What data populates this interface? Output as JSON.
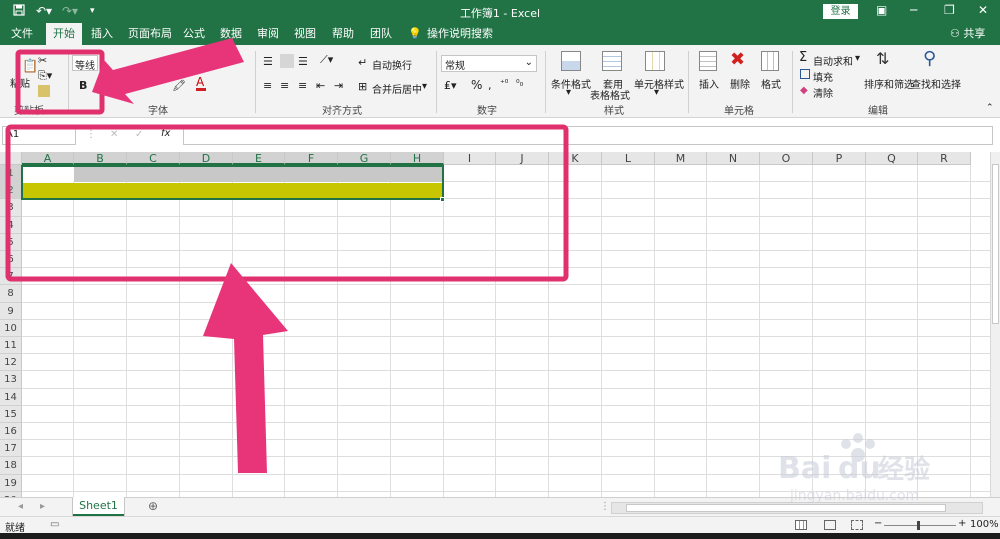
{
  "app": {
    "window_title": "工作簿1 - Excel",
    "login_label": "登录",
    "share_label": "共享"
  },
  "tabs": [
    "文件",
    "开始",
    "插入",
    "页面布局",
    "公式",
    "数据",
    "审阅",
    "视图",
    "帮助",
    "团队",
    "操作说明搜索"
  ],
  "active_tab": "开始",
  "ribbon": {
    "clipboard": {
      "label": "剪贴板",
      "paste": "粘贴"
    },
    "font": {
      "label": "字体",
      "font_name": "等线",
      "bold": "B"
    },
    "alignment": {
      "label": "对齐方式",
      "wrap_text": "自动换行",
      "merge_center": "合并后居中"
    },
    "number": {
      "label": "数字",
      "format": "常规"
    },
    "styles": {
      "label": "样式",
      "conditional": "条件格式",
      "table_format_1": "套用",
      "table_format_2": "表格格式",
      "cell_styles": "单元格样式"
    },
    "cells": {
      "label": "单元格",
      "insert": "插入",
      "delete": "删除",
      "format": "格式"
    },
    "editing": {
      "label": "编辑",
      "autosum": "自动求和",
      "fill": "填充",
      "clear": "清除",
      "sort_filter": "排序和筛选",
      "find_select": "查找和选择"
    }
  },
  "formula_bar": {
    "name_box": "A1",
    "fx": "fx",
    "value": ""
  },
  "grid": {
    "columns": [
      "A",
      "B",
      "C",
      "D",
      "E",
      "F",
      "G",
      "H",
      "I",
      "J",
      "K",
      "L",
      "M",
      "N",
      "O",
      "P",
      "Q",
      "R"
    ],
    "selected_columns": [
      "A",
      "B",
      "C",
      "D",
      "E",
      "F",
      "G",
      "H"
    ],
    "rows": [
      "1",
      "2",
      "3",
      "4",
      "5",
      "6",
      "7",
      "8",
      "9",
      "10",
      "11",
      "12",
      "13",
      "14",
      "15",
      "16",
      "17",
      "18",
      "19",
      "20",
      "21"
    ],
    "selected_rows": [
      "1",
      "2"
    ],
    "header_fill_row": "1",
    "highlight_row": "2",
    "header_fill_color": "#c8c8c8",
    "highlight_color": "#c8c600"
  },
  "sheets": [
    "Sheet1"
  ],
  "status": {
    "ready": "就绪",
    "zoom": "100%"
  },
  "watermark": {
    "brand": "Bai du 经验",
    "url": "jingyan.baidu.com"
  },
  "annotation": {
    "frame_color": "#e0306e",
    "arrow_color": "#e8357a"
  }
}
